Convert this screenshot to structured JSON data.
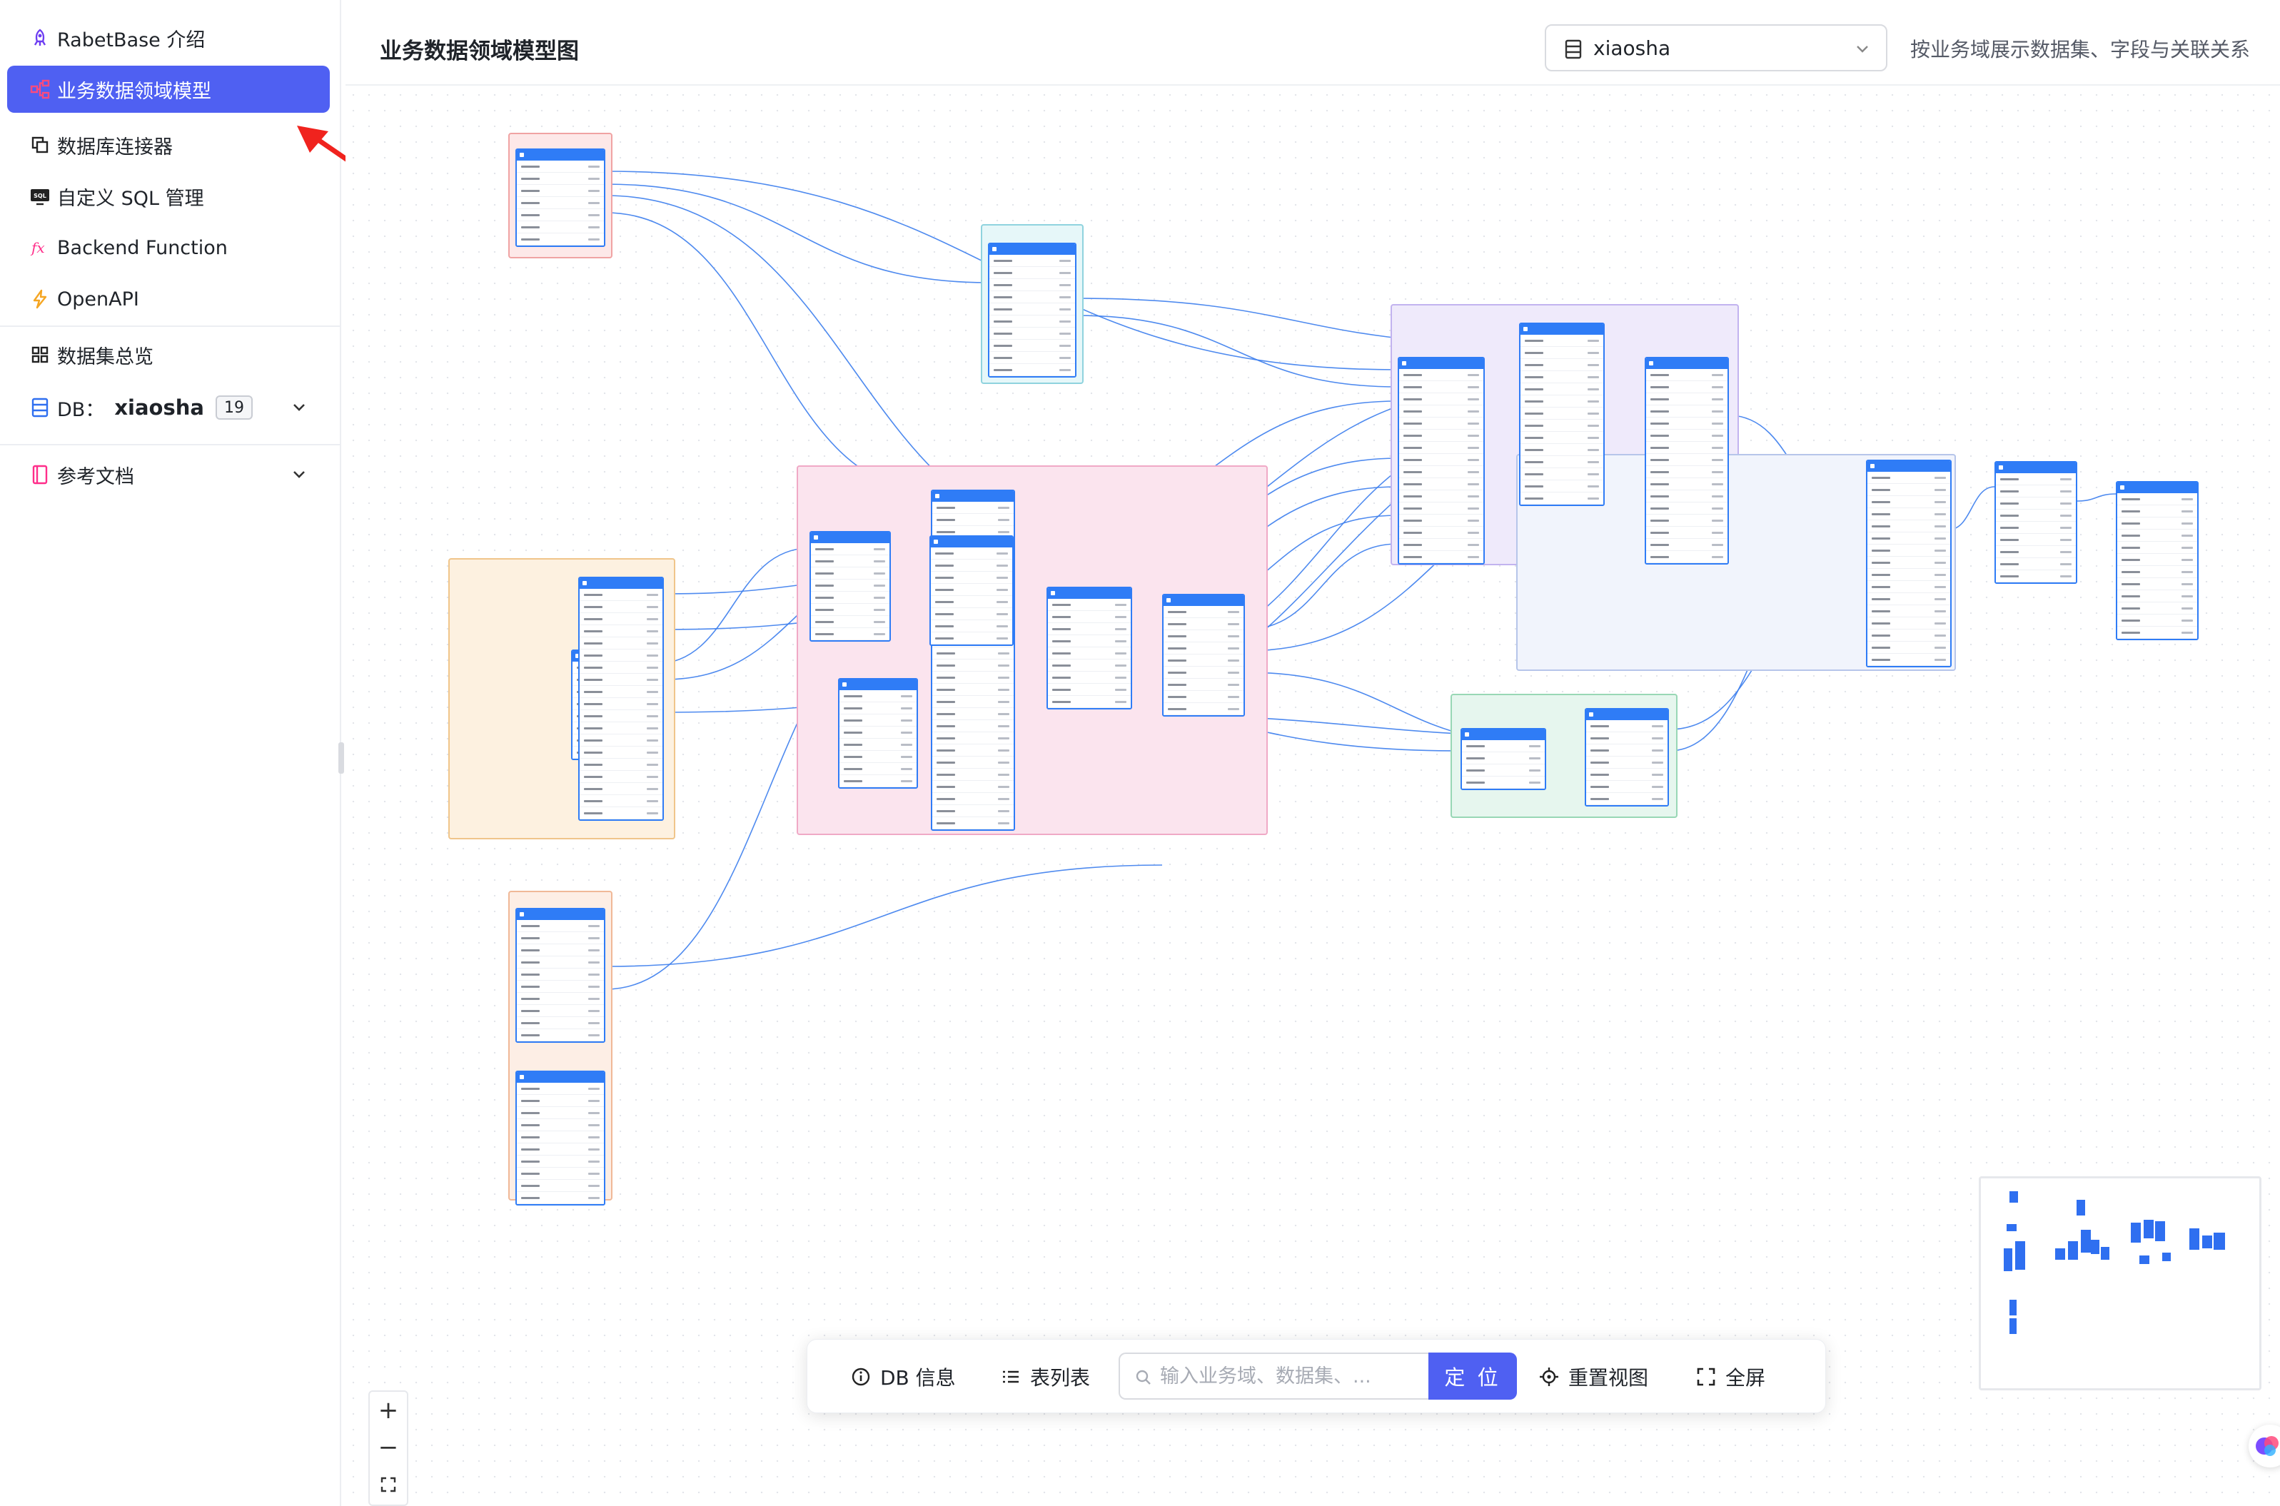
{
  "sidebar": {
    "items": [
      {
        "label": "RabetBase 介绍",
        "icon": "rocket-icon"
      },
      {
        "label": "业务数据领域模型",
        "icon": "schema-network-icon",
        "active": true
      },
      {
        "label": "数据库连接器",
        "icon": "copy-connector-icon"
      },
      {
        "label": "自定义 SQL 管理",
        "icon": "sql-icon"
      },
      {
        "label": "Backend Function",
        "icon": "function-fx-icon"
      },
      {
        "label": "OpenAPI",
        "icon": "lightning-icon"
      },
      {
        "label": "数据集总览",
        "icon": "grid-icon"
      }
    ],
    "db": {
      "prefix": "DB：",
      "name": "xiaosha",
      "count": "19"
    },
    "docs": {
      "label": "参考文档",
      "icon": "book-icon"
    }
  },
  "header": {
    "title": "业务数据领域模型图",
    "db_select": {
      "value": "xiaosha",
      "icon": "database-icon"
    },
    "description": "按业务域展示数据集、字段与关联关系"
  },
  "toolbar": {
    "db_info": "DB 信息",
    "table_list": "表列表",
    "search_placeholder": "输入业务域、数据集、...",
    "locate": "定 位",
    "reset_view": "重置视图",
    "fullscreen": "全屏"
  },
  "zoom": {
    "in": "+",
    "out": "−"
  },
  "colors": {
    "accent": "#4f60f2",
    "table_header": "#2f7cf6",
    "edge": "#3b7ded",
    "arrow": "#f0231e"
  }
}
